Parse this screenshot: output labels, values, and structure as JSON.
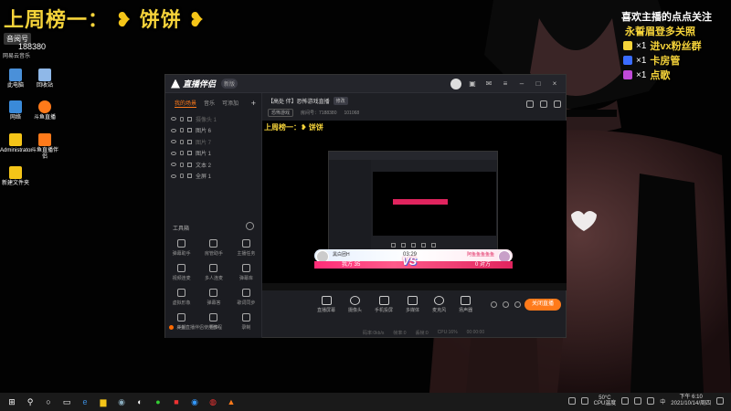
{
  "overlay": {
    "rank_title": "上周榜一：",
    "rank_name": "饼饼",
    "heart": "❥",
    "fan_label": "音阅号",
    "fan_count": "188380",
    "music_app": "网易云音乐",
    "follow_title": "喜欢主播的点点关注",
    "follow_sub": "永誓眉登多关照",
    "gifts": [
      {
        "count": "×1",
        "text": "进vx粉丝群",
        "color": "#f5d33a"
      },
      {
        "count": "×1",
        "text": "卡房管",
        "color": "#3a6cff"
      },
      {
        "count": "×1",
        "text": "点歌",
        "color": "#c04ad8"
      }
    ]
  },
  "desktop_icons": [
    {
      "label": "此电脑",
      "color": "#4a90d9"
    },
    {
      "label": "回收站",
      "color": "#8fb8e8"
    },
    {
      "label": "网络",
      "color": "#3a8ad9"
    },
    {
      "label": "斗鱼直播",
      "color": "#ff7a1a"
    },
    {
      "label": "Administrator",
      "color": "#f5c518"
    },
    {
      "label": "斗鱼直播伴侣",
      "color": "#ff7a1a"
    },
    {
      "label": "新建文件夹",
      "color": "#f5c518"
    }
  ],
  "app": {
    "name": "直播伴侣",
    "version": "新版",
    "left_tabs": [
      "我的场景",
      "音乐",
      "可添加"
    ],
    "add_label": "+",
    "scenes": [
      {
        "name": "摄像头 1",
        "dim": true
      },
      {
        "name": "图片 6",
        "dim": false
      },
      {
        "name": "图片 7",
        "dim": true
      },
      {
        "name": "图片 1",
        "dim": false
      },
      {
        "name": "文本 2",
        "dim": false
      },
      {
        "name": "全屏 1",
        "dim": false
      }
    ],
    "tools_title": "工具箱",
    "tools": [
      {
        "label": "弹幕助手"
      },
      {
        "label": "房管助手"
      },
      {
        "label": "主播任务"
      },
      {
        "label": "视频连麦"
      },
      {
        "label": "多人连麦"
      },
      {
        "label": "弹幕库"
      },
      {
        "label": "虚拟形象"
      },
      {
        "label": "弹幕答"
      },
      {
        "label": "歌词同步"
      },
      {
        "label": "美颜"
      },
      {
        "label": "更多"
      },
      {
        "label": "录制"
      }
    ],
    "left_bottom": "斗鱼直播伴侣使用教程",
    "room_title": "【高处 伴】恐怖游戏直播",
    "room_edit": "修改",
    "room_category": "恐怖游戏",
    "room_id": "房间号：7188380",
    "room_hot": "101068",
    "preview": {
      "banner": "上周榜一：❥ 饼饼",
      "pk_left_name": "黑白团H",
      "pk_timer": "03:29",
      "pk_right_name": "阿鱼鱼鱼鱼鱼",
      "pk_left_score": "我方 35",
      "pk_right_score": "0 对方",
      "vs": "VS"
    },
    "controls": [
      {
        "label": "直播屏幕"
      },
      {
        "label": "摄像头"
      },
      {
        "label": "手机投屏"
      },
      {
        "label": "多媒体"
      },
      {
        "label": "麦克风"
      },
      {
        "label": "扬声器"
      }
    ],
    "go_live": "关闭直播",
    "status": [
      "码率:0kb/s",
      "帧率:0",
      "丢帧:0",
      "CPU:16%",
      "00:00:00"
    ]
  },
  "taskbar": {
    "temperature": "50°C",
    "temp_label": "CPU温度",
    "time": "下午 6:10",
    "date": "2021/10/14/周四",
    "ime": "中"
  }
}
